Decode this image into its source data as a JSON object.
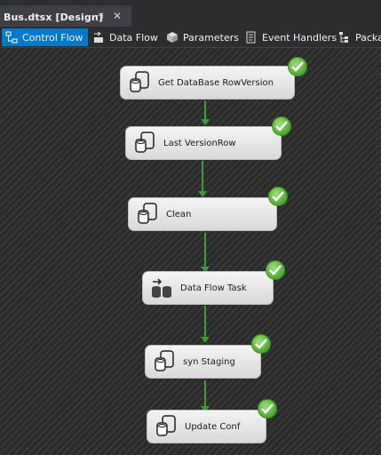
{
  "document_tab": {
    "title": "Bus.dtsx [Design]",
    "pin_icon": "pin-icon",
    "close_icon": "close-icon"
  },
  "designer_tabs": [
    {
      "label": "Control Flow",
      "icon": "control-flow-icon",
      "active": true
    },
    {
      "label": "Data Flow",
      "icon": "data-flow-icon",
      "active": false
    },
    {
      "label": "Parameters",
      "icon": "parameters-icon",
      "active": false
    },
    {
      "label": "Event Handlers",
      "icon": "event-handlers-icon",
      "active": false
    },
    {
      "label": "Packa",
      "icon": "package-explorer-icon",
      "active": false
    }
  ],
  "tasks": [
    {
      "label": "Get DataBase RowVersion",
      "type": "execute-sql",
      "status": "success"
    },
    {
      "label": "Last VersionRow",
      "type": "execute-sql",
      "status": "success"
    },
    {
      "label": "Clean",
      "type": "execute-sql",
      "status": "success"
    },
    {
      "label": "Data Flow Task",
      "type": "data-flow",
      "status": "success"
    },
    {
      "label": "syn Staging",
      "type": "execute-sql",
      "status": "success"
    },
    {
      "label": "Update Conf",
      "type": "execute-sql",
      "status": "success"
    }
  ],
  "colors": {
    "accent": "#007acc",
    "success": "#4ea72e",
    "connector": "#3d9a3a"
  }
}
